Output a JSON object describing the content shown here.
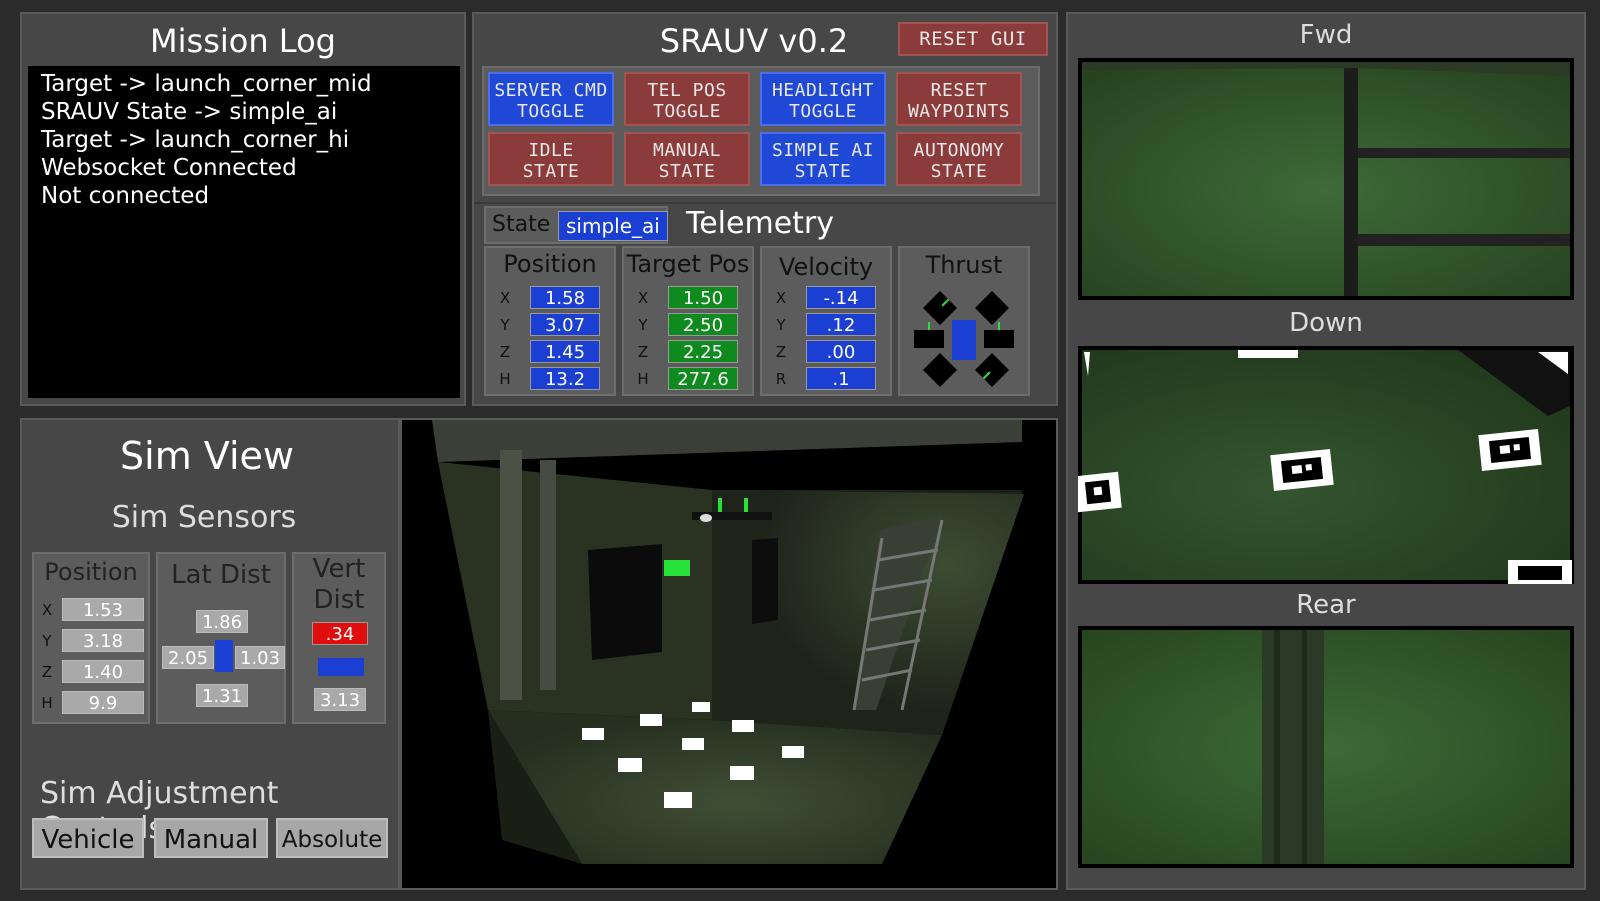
{
  "mission_log": {
    "title": "Mission Log",
    "lines": [
      "Target -> launch_corner_mid",
      "SRAUV State -> simple_ai",
      "Target -> launch_corner_hi",
      "Websocket Connected",
      "Not connected"
    ]
  },
  "header": {
    "title": "SRAUV v0.2",
    "reset_gui": "RESET GUI"
  },
  "controls": {
    "buttons": [
      {
        "line1": "SERVER CMD",
        "line2": "TOGGLE",
        "color": "#1f48d6"
      },
      {
        "line1": "TEL POS",
        "line2": "TOGGLE",
        "color": "#8c3b3b"
      },
      {
        "line1": "HEADLIGHT",
        "line2": "TOGGLE",
        "color": "#1f48d6"
      },
      {
        "line1": "RESET",
        "line2": "WAYPOINTS",
        "color": "#8c3b3b"
      },
      {
        "line1": "IDLE",
        "line2": "STATE",
        "color": "#8c3b3b"
      },
      {
        "line1": "MANUAL",
        "line2": "STATE",
        "color": "#8c3b3b"
      },
      {
        "line1": "SIMPLE AI",
        "line2": "STATE",
        "color": "#1f48d6"
      },
      {
        "line1": "AUTONOMY",
        "line2": "STATE",
        "color": "#8c3b3b"
      }
    ]
  },
  "telemetry": {
    "title": "Telemetry",
    "state_label": "State",
    "state_value": "simple_ai",
    "position": {
      "title": "Position",
      "labels": [
        "X",
        "Y",
        "Z",
        "H"
      ],
      "values": [
        "1.58",
        "3.07",
        "1.45",
        "13.2"
      ]
    },
    "target_pos": {
      "title": "Target Pos",
      "labels": [
        "X",
        "Y",
        "Z",
        "H"
      ],
      "values": [
        "1.50",
        "2.50",
        "2.25",
        "277.6"
      ]
    },
    "velocity": {
      "title": "Velocity",
      "labels": [
        "X",
        "Y",
        "Z",
        "R"
      ],
      "values": [
        "-.14",
        ".12",
        ".00",
        ".1"
      ]
    },
    "thrust": {
      "title": "Thrust"
    }
  },
  "cameras": {
    "fwd": "Fwd",
    "down": "Down",
    "rear": "Rear"
  },
  "sim": {
    "title": "Sim View",
    "sensors_title": "Sim Sensors",
    "position": {
      "title": "Position",
      "labels": [
        "X",
        "Y",
        "Z",
        "H"
      ],
      "values": [
        "1.53",
        "3.18",
        "1.40",
        "9.9"
      ]
    },
    "lat_dist": {
      "title": "Lat Dist",
      "top": "1.86",
      "left": "2.05",
      "right": "1.03",
      "bottom": "1.31"
    },
    "vert_dist": {
      "title_line1": "Vert",
      "title_line2": "Dist",
      "top": ".34",
      "bottom": "3.13"
    },
    "adjust_title": "Sim Adjustment Controls",
    "adjust_buttons": [
      "Vehicle",
      "Manual",
      "Absolute"
    ]
  },
  "colors": {
    "accent_blue": "#1f48d6",
    "accent_red": "#8c3b3b",
    "value_green": "#0f8a1e",
    "alert_red": "#e00d0d",
    "camera_green": "#2e4a2a"
  }
}
